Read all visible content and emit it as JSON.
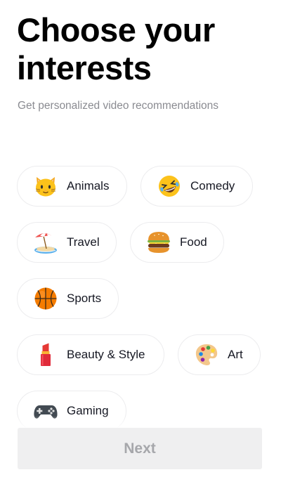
{
  "header": {
    "title": "Choose your interests",
    "subtitle": "Get personalized video recommendations"
  },
  "interests": [
    {
      "label": "Animals",
      "icon": "cat-face-icon"
    },
    {
      "label": "Comedy",
      "icon": "laughing-face-icon"
    },
    {
      "label": "Travel",
      "icon": "beach-umbrella-icon"
    },
    {
      "label": "Food",
      "icon": "hamburger-icon"
    },
    {
      "label": "Sports",
      "icon": "basketball-icon"
    },
    {
      "label": "Beauty & Style",
      "icon": "lipstick-icon"
    },
    {
      "label": "Art",
      "icon": "palette-icon"
    },
    {
      "label": "Gaming",
      "icon": "game-controller-icon"
    }
  ],
  "footer": {
    "next_label": "Next"
  },
  "colors": {
    "title": "#000000",
    "subtitle": "#8a8b91",
    "chip_border": "#ececee",
    "button_bg_disabled": "#efeff0",
    "button_text_disabled": "#a6a7ab"
  }
}
